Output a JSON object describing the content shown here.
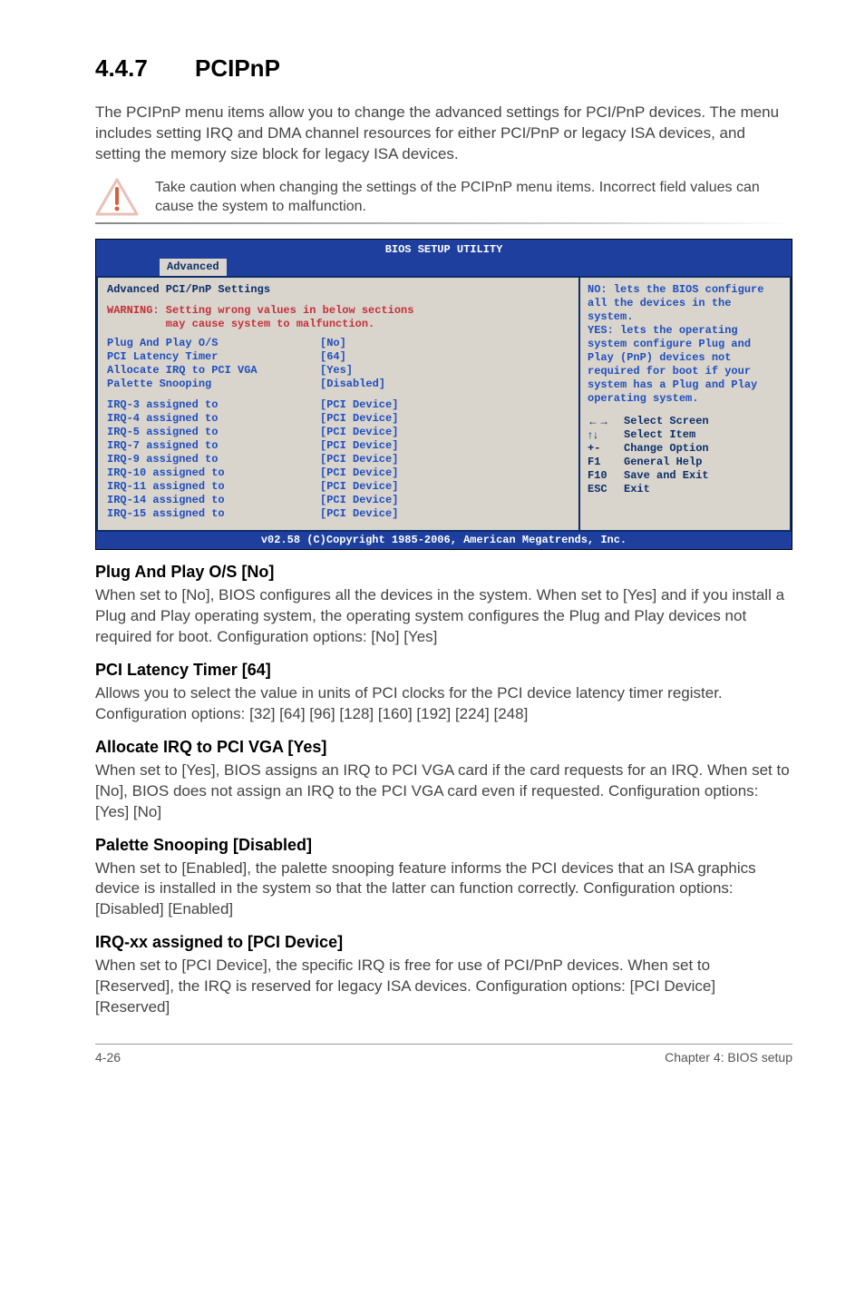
{
  "section": {
    "number": "4.4.7",
    "title": "PCIPnP"
  },
  "intro": "The PCIPnP menu items allow you to change the advanced settings for PCI/PnP devices. The menu includes setting IRQ and DMA channel resources for either PCI/PnP or legacy ISA devices, and setting the memory size block for legacy ISA devices.",
  "note": "Take caution when changing the settings of the PCIPnP menu items. Incorrect field values can cause the system to malfunction.",
  "bios": {
    "title": "BIOS SETUP UTILITY",
    "tab": "Advanced",
    "heading": "Advanced PCI/PnP Settings",
    "warning_l1": "WARNING: Setting wrong values in below sections",
    "warning_l2": "         may cause system to malfunction.",
    "settings": [
      {
        "k": "Plug And Play O/S",
        "v": "[No]"
      },
      {
        "k": "PCI Latency Timer",
        "v": "[64]"
      },
      {
        "k": "Allocate IRQ to PCI VGA",
        "v": "[Yes]"
      },
      {
        "k": "Palette Snooping",
        "v": "[Disabled]"
      }
    ],
    "irqs": [
      {
        "k": "IRQ-3 assigned to",
        "v": "[PCI Device]"
      },
      {
        "k": "IRQ-4 assigned to",
        "v": "[PCI Device]"
      },
      {
        "k": "IRQ-5 assigned to",
        "v": "[PCI Device]"
      },
      {
        "k": "IRQ-7 assigned to",
        "v": "[PCI Device]"
      },
      {
        "k": "IRQ-9 assigned to",
        "v": "[PCI Device]"
      },
      {
        "k": "IRQ-10 assigned to",
        "v": "[PCI Device]"
      },
      {
        "k": "IRQ-11 assigned to",
        "v": "[PCI Device]"
      },
      {
        "k": "IRQ-14 assigned to",
        "v": "[PCI Device]"
      },
      {
        "k": "IRQ-15 assigned to",
        "v": "[PCI Device]"
      }
    ],
    "help": "NO: lets the BIOS configure all the devices in the system.\nYES: lets the operating system configure Plug and Play (PnP) devices not required for boot if your system has a Plug and Play operating system.",
    "keys": [
      {
        "s": "←→",
        "t": "Select Screen"
      },
      {
        "s": "↑↓",
        "t": "Select Item"
      },
      {
        "s": "+-",
        "t": "Change Option"
      },
      {
        "s": "F1",
        "t": "General Help"
      },
      {
        "s": "F10",
        "t": "Save and Exit"
      },
      {
        "s": "ESC",
        "t": "Exit"
      }
    ],
    "footer": "v02.58 (C)Copyright 1985-2006, American Megatrends, Inc."
  },
  "subs": [
    {
      "h": "Plug And Play O/S [No]",
      "p": "When set to [No], BIOS configures all the devices in the system. When set to [Yes] and if you install a Plug and Play operating system, the operating system configures the Plug and Play devices not required for boot. Configuration options: [No] [Yes]"
    },
    {
      "h": "PCI Latency Timer [64]",
      "p": "Allows you to select the value in units of PCI clocks for the PCI device latency timer register. Configuration options: [32] [64] [96] [128] [160] [192] [224] [248]"
    },
    {
      "h": "Allocate IRQ to PCI VGA [Yes]",
      "p": "When set to [Yes], BIOS assigns an IRQ to PCI VGA card if the card requests for an IRQ. When set to [No], BIOS does not assign an IRQ to the PCI VGA card even if requested. Configuration options: [Yes] [No]"
    },
    {
      "h": "Palette Snooping [Disabled]",
      "p": "When set to [Enabled], the palette snooping feature informs the PCI devices that an ISA graphics device is installed in the system so that the latter can function correctly. Configuration options: [Disabled] [Enabled]"
    },
    {
      "h": "IRQ-xx assigned to [PCI Device]",
      "p": "When set to [PCI Device], the specific IRQ is free for use of PCI/PnP devices. When set to [Reserved], the IRQ is reserved for legacy ISA devices. Configuration options: [PCI Device] [Reserved]"
    }
  ],
  "footer": {
    "left": "4-26",
    "right": "Chapter 4: BIOS setup"
  }
}
